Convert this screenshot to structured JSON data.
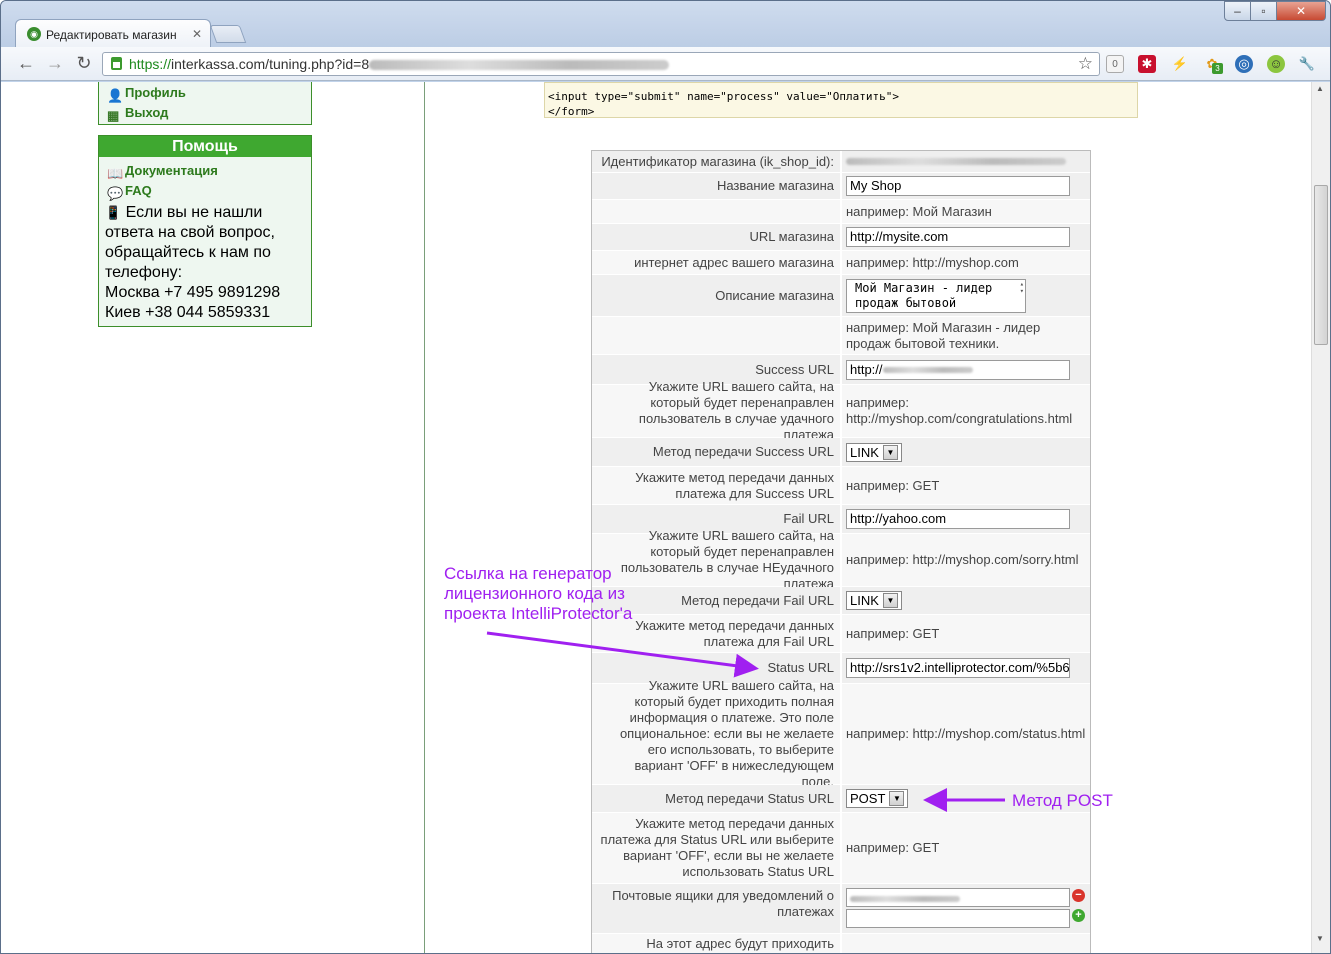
{
  "browser": {
    "tab_title": "Редактировать магазин",
    "url_scheme": "https://",
    "url_rest": "interkassa.com/tuning.php?id=8",
    "counter_badge": "0",
    "ext_badge": "3"
  },
  "sidebar": {
    "links": [
      {
        "label": "Профиль"
      },
      {
        "label": "Выход"
      }
    ],
    "help": {
      "title": "Помощь",
      "links": [
        {
          "label": "Документация"
        },
        {
          "label": "FAQ"
        }
      ],
      "text_lines": [
        "Если вы не нашли",
        "ответа на свой вопрос,",
        "обращайтесь к нам по",
        "телефону:",
        "Москва +7 495 9891298",
        "Киев +38 044 5859331"
      ]
    }
  },
  "code_snippet": {
    "line1": "<input type=\"submit\" name=\"process\" value=\"Оплатить\">",
    "line2": "</form>"
  },
  "form": {
    "shop_id_label": "Идентификатор магазина (ik_shop_id):",
    "shop_name_label": "Название магазина",
    "shop_name_value": "My Shop",
    "shop_name_hint": "например: Мой Магазин",
    "shop_url_label": "URL магазина",
    "shop_url_value": "http://mysite.com",
    "shop_url_note": "интернет адрес вашего магазина",
    "shop_url_hint": "например: http://myshop.com",
    "desc_label": "Описание магазина",
    "desc_value_l1": "Мой Магазин - лидер",
    "desc_value_l2": "продаж бытовой",
    "desc_hint": "например: Мой Магазин - лидер продаж бытовой техники.",
    "success_url_label": "Success URL",
    "success_url_value": "http://",
    "success_url_note": "Укажите URL вашего сайта, на который будет перенаправлен пользователь в случае удачного платежа",
    "success_url_hint": "например: http://myshop.com/congratulations.html",
    "success_method_label": "Метод передачи Success URL",
    "success_method_value": "LINK",
    "success_method_note": "Укажите метод передачи данных платежа для Success URL",
    "success_method_hint": "например: GET",
    "fail_url_label": "Fail URL",
    "fail_url_value": "http://yahoo.com",
    "fail_url_note": "Укажите URL вашего сайта, на который будет перенаправлен пользователь в случае НЕудачного платежа",
    "fail_url_hint": "например: http://myshop.com/sorry.html",
    "fail_method_label": "Метод передачи Fail URL",
    "fail_method_value": "LINK",
    "fail_method_note": "Укажите метод передачи данных платежа для Fail URL",
    "fail_method_hint": "например: GET",
    "status_url_label": "Status URL",
    "status_url_value": "http://srs1v2.intelliprotector.com/%5b6",
    "status_url_note": "Укажите URL вашего сайта, на который будет приходить полная информация о платеже. Это поле опциональное: если вы не желаете его использовать, то выберите вариант 'OFF' в нижеследующем поле.",
    "status_url_hint": "например: http://myshop.com/status.html",
    "status_method_label": "Метод передачи Status URL",
    "status_method_value": "POST",
    "status_method_note": "Укажите метод передачи данных платежа для Status URL или выберите вариант 'OFF', если вы не желаете использовать Status URL",
    "status_method_hint": "например: GET",
    "emails_label": "Почтовые ящики для уведомлений о платежах",
    "next_partial": "На этот адрес будут приходить"
  },
  "annotations": {
    "status_note_l1": "Ссылка на генератор",
    "status_note_l2": "лицензионного кода из",
    "status_note_l3": "проекта IntelliProtector'а",
    "post_note": "Метод POST",
    "color": "#a020f0"
  }
}
